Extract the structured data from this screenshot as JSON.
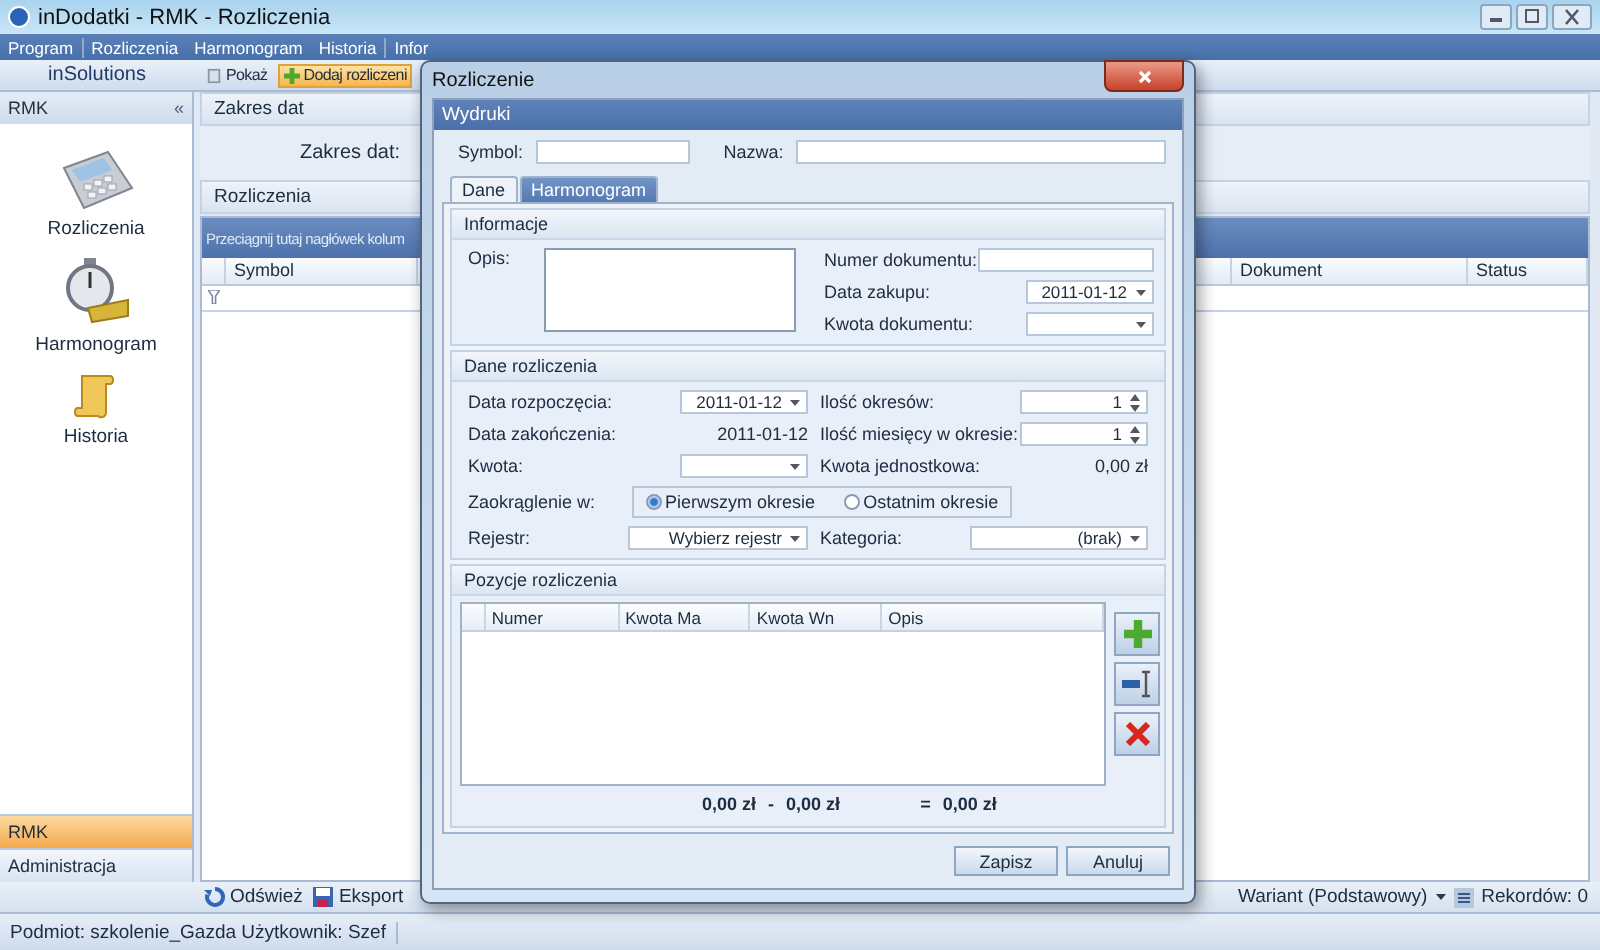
{
  "app": {
    "title": "inDodatki - RMK - Rozliczenia"
  },
  "menu_groups": [
    [
      "Program"
    ],
    [
      "Rozliczenia",
      "Harmonogram",
      "Historia"
    ],
    [
      "Infor"
    ]
  ],
  "toolbar": {
    "brand": "inSolutions",
    "buttons": [
      {
        "label": "Pokaż",
        "kind": "view",
        "highlighted": false
      },
      {
        "label": "Dodaj rozliczeni",
        "kind": "add",
        "highlighted": true
      }
    ]
  },
  "sidebar": {
    "title": "RMK",
    "collapse": "«",
    "items": [
      {
        "label": "Rozliczenia",
        "kind": "calculator"
      },
      {
        "label": "Harmonogram",
        "kind": "stopwatch"
      },
      {
        "label": "Historia",
        "kind": "scroll"
      }
    ],
    "nav": [
      {
        "label": "RMK",
        "selected": true
      },
      {
        "label": "Administracja",
        "selected": false
      }
    ]
  },
  "date_range": {
    "title": "Zakres dat",
    "label": "Zakres dat:"
  },
  "grid": {
    "title": "Rozliczenia",
    "group_hint": "Przeciągnij tutaj nagłówek kolum",
    "columns": [
      "Symbol",
      "Dokument",
      "Status"
    ]
  },
  "bottom_bar": {
    "buttons": [
      {
        "label": "Odśwież",
        "kind": "refresh"
      },
      {
        "label": "Eksport",
        "kind": "export"
      }
    ],
    "variant": "Wariant (Podstawowy)",
    "records": "Rekordów: 0"
  },
  "status_bar": "Podmiot: szkolenie_Gazda Użytkownik: Szef",
  "dialog": {
    "title": "Rozliczenie",
    "menu": "Wydruki",
    "symbol_label": "Symbol:",
    "name_label": "Nazwa:",
    "tabs": [
      {
        "label": "Dane",
        "selected": true
      },
      {
        "label": "Harmonogram",
        "selected": false
      }
    ],
    "info": {
      "title": "Informacje",
      "description_label": "Opis:",
      "fields": [
        {
          "label": "Numer dokumentu:",
          "kind": "text"
        },
        {
          "label": "Data zakupu:",
          "kind": "dropdown",
          "value": "2011-01-12"
        },
        {
          "label": "Kwota dokumentu:",
          "kind": "dropdown"
        }
      ]
    },
    "settlement": {
      "title": "Dane rozliczenia",
      "left": [
        {
          "label": "Data rozpoczęcia:",
          "kind": "dropdown",
          "value": "2011-01-12"
        },
        {
          "label": "Data zakończenia:",
          "kind": "readout",
          "value": "2011-01-12"
        },
        {
          "label": "Kwota:",
          "kind": "dropdown"
        }
      ],
      "right": [
        {
          "label": "Ilość okresów:",
          "kind": "spinner",
          "value": "1"
        },
        {
          "label": "Ilość miesięcy w okresie:",
          "kind": "spinner",
          "value": "1"
        },
        {
          "label": "Kwota jednostkowa:",
          "kind": "readout",
          "value": "0,00 zł"
        }
      ],
      "rounding": {
        "label": "Zaokrąglenie w:",
        "options": [
          {
            "label": "Pierwszym okresie",
            "selected": true
          },
          {
            "label": "Ostatnim okresie",
            "selected": false
          }
        ]
      },
      "register": {
        "label": "Rejestr:",
        "value": "Wybierz rejestr"
      },
      "category": {
        "label": "Kategoria:",
        "value": "(brak)"
      }
    },
    "positions": {
      "title": "Pozycje rozliczenia",
      "columns": [
        "Numer",
        "Kwota Ma",
        "Kwota Wn",
        "Opis"
      ],
      "actions": [
        {
          "kind": "add"
        },
        {
          "kind": "remove"
        },
        {
          "kind": "delete"
        }
      ],
      "sum_ma": "0,00 zł",
      "minus": "-",
      "sum_wn": "0,00 zł",
      "equals": "=",
      "total": "0,00 zł"
    },
    "buttons": [
      "Zapisz",
      "Anuluj"
    ]
  }
}
